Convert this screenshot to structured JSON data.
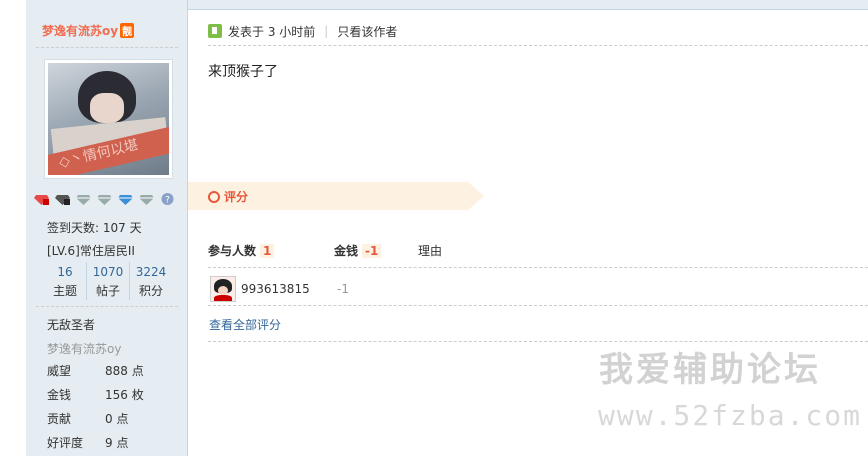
{
  "author": {
    "name": "梦逸有流苏oy",
    "badge": "靓",
    "medals": [
      "medal-red-icon",
      "medal-black-icon",
      "medal-silver-icon",
      "medal-silver-icon",
      "medal-blue-icon",
      "medal-silver-icon",
      "help-icon"
    ],
    "checkin": "签到天数: 107 天",
    "level": "[LV.6]常住居民II",
    "stats": [
      {
        "num": "16",
        "label": "主题"
      },
      {
        "num": "1070",
        "label": "帖子"
      },
      {
        "num": "3224",
        "label": "积分"
      }
    ],
    "title": "无敌圣者",
    "signature": "梦逸有流苏oy",
    "fields": [
      {
        "key": "威望",
        "value": "888 点"
      },
      {
        "key": "金钱",
        "value": "156 枚"
      },
      {
        "key": "贡献",
        "value": "0 点"
      },
      {
        "key": "好评度",
        "value": "9 点"
      }
    ]
  },
  "post": {
    "posted": "发表于 3 小时前",
    "only_author": "只看该作者",
    "body": "来顶猴子了"
  },
  "rating": {
    "section_label": "评分",
    "col_participants": "参与人数",
    "participants_count": "1",
    "col_money": "金钱",
    "money_total": "-1",
    "col_reason": "理由",
    "rows": [
      {
        "user": "993613815",
        "value": "-1"
      }
    ],
    "view_all": "查看全部评分"
  },
  "watermark": {
    "line1": "我爱辅助论坛",
    "line2": "www.52fzba.com"
  },
  "colors": {
    "accent": "#f26c4f",
    "link": "#336699",
    "sidebar_bg": "#e5edf2",
    "rating_bg": "#fdf2e1"
  }
}
